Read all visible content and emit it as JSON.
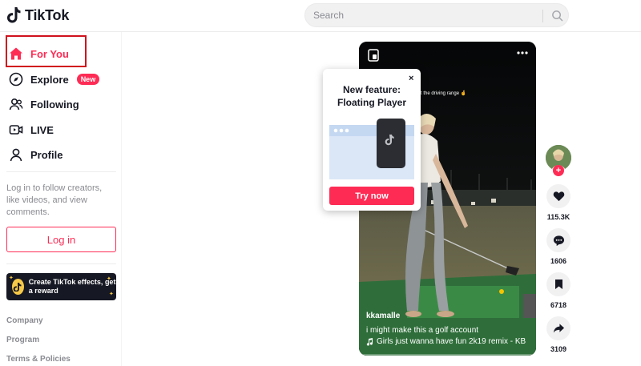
{
  "header": {
    "logo_text": "TikTok",
    "search_placeholder": "Search"
  },
  "sidebar": {
    "nav": [
      {
        "label": "For You",
        "icon": "home-icon",
        "active": true
      },
      {
        "label": "Explore",
        "icon": "compass-icon",
        "badge": "New"
      },
      {
        "label": "Following",
        "icon": "people-icon"
      },
      {
        "label": "LIVE",
        "icon": "live-icon"
      },
      {
        "label": "Profile",
        "icon": "profile-icon"
      }
    ],
    "login_prompt": "Log in to follow creators, like videos, and view comments.",
    "login_button": "Log in",
    "effects_banner": "Create TikTok effects, get a reward",
    "footer_links": [
      "Company",
      "Program",
      "Terms & Policies"
    ]
  },
  "video": {
    "overlay_caption": "girl at the driving range 🤞",
    "username": "kkamalle",
    "description": "i might make this a golf account",
    "music": "Girls just wanna have fun 2k19 remix - KB",
    "progress": 0.0
  },
  "popup": {
    "close": "×",
    "title_line1": "New feature:",
    "title_line2": "Floating Player",
    "button": "Try now"
  },
  "actions": {
    "likes": "115.3K",
    "comments": "1606",
    "saves": "6718",
    "shares": "3109"
  },
  "colors": {
    "accent": "#fe2c55",
    "highlight_box": "#d0111d"
  }
}
